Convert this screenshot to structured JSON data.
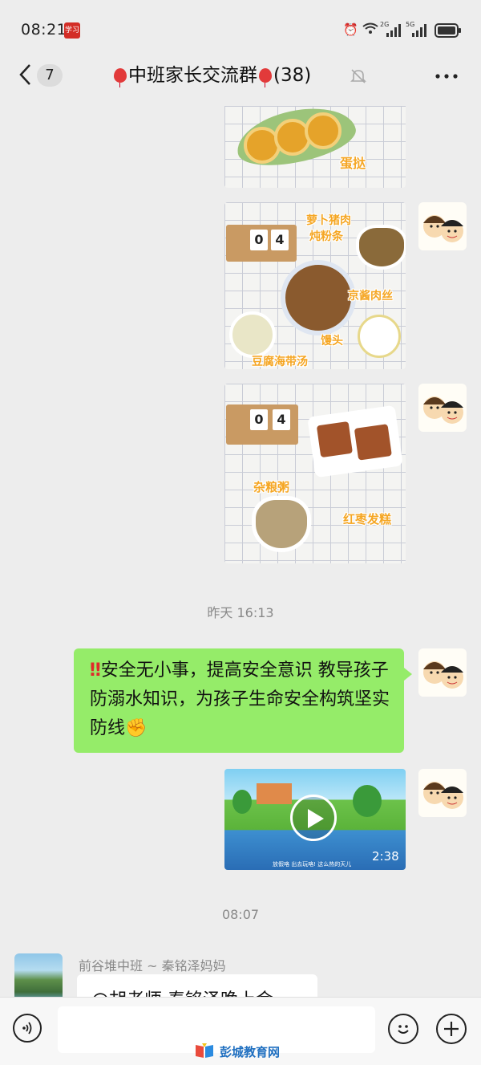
{
  "status_bar": {
    "time": "08:21",
    "app_badge": "学习",
    "network_1": "2G",
    "network_2": "5G"
  },
  "header": {
    "back_count": "7",
    "title": "中班家长交流群",
    "member_count": "(38)"
  },
  "messages": {
    "egg_tart_label": "蛋挞",
    "lunch_labels": [
      "萝卜猪肉",
      "炖粉条",
      "京酱肉丝",
      "馒头",
      "豆腐海带汤"
    ],
    "calendar_digits": [
      "0",
      "4"
    ],
    "snack_labels": [
      "杂粮粥",
      "红枣发糕"
    ],
    "timestamp_1": "昨天 16:13",
    "text_message": "安全无小事，提高安全意识 教导孩子防溺水知识，为孩子生命安全构筑坚实防线",
    "video_duration": "2:38",
    "video_caption": "放假咯  出去玩咯! 这么热的天儿",
    "timestamp_2": "08:07",
    "sender_name": "前谷堆中班 ~ 秦铭泽妈妈",
    "incoming_text": "@胡老师  秦铭泽晚上会"
  },
  "watermark": "彭城教育网",
  "colors": {
    "bubble_green": "#95ec69",
    "background": "#ededed",
    "label_orange": "#f5a623"
  }
}
